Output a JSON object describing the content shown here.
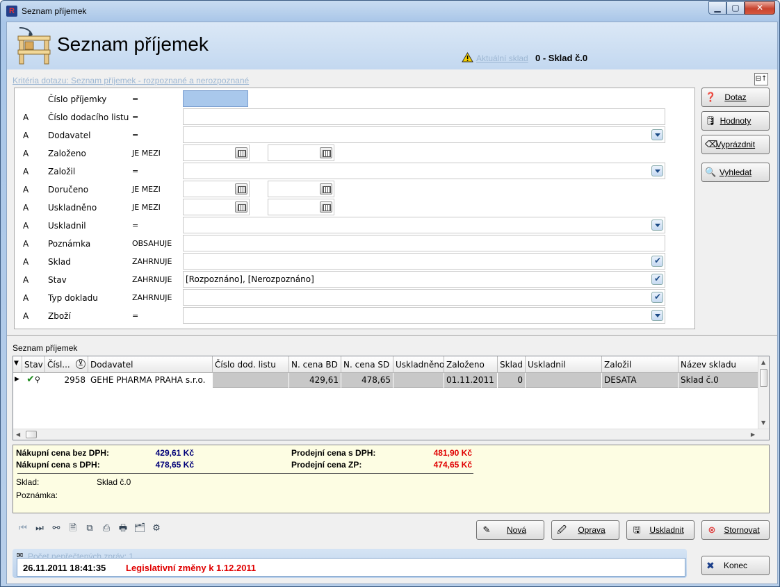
{
  "window": {
    "title": "Seznam příjemek",
    "app_icon": "R"
  },
  "header": {
    "title": "Seznam příjemek",
    "current_warehouse_label": "Aktuální sklad",
    "current_warehouse_value": "0 - Sklad č.0"
  },
  "criteria": {
    "link": "Kritéria dotazu: Seznam příjemek - rozpoznané a nerozpoznané",
    "rows": [
      {
        "a": "",
        "label": "Číslo příjemky",
        "op": "="
      },
      {
        "a": "A",
        "label": "Číslo dodacího listu",
        "op": "="
      },
      {
        "a": "A",
        "label": "Dodavatel",
        "op": "="
      },
      {
        "a": "A",
        "label": "Založeno",
        "op": "JE MEZI"
      },
      {
        "a": "A",
        "label": "Založil",
        "op": "="
      },
      {
        "a": "A",
        "label": "Doručeno",
        "op": "JE MEZI"
      },
      {
        "a": "A",
        "label": "Uskladněno",
        "op": "JE MEZI"
      },
      {
        "a": "A",
        "label": "Uskladnil",
        "op": "="
      },
      {
        "a": "A",
        "label": "Poznámka",
        "op": "OBSAHUJE"
      },
      {
        "a": "A",
        "label": "Sklad",
        "op": "ZAHRNUJE"
      },
      {
        "a": "A",
        "label": "Stav",
        "op": "ZAHRNUJE",
        "value": "[Rozpoznáno], [Nerozpoznáno]"
      },
      {
        "a": "A",
        "label": "Typ dokladu",
        "op": "ZAHRNUJE"
      },
      {
        "a": "A",
        "label": "Zboží",
        "op": "="
      }
    ]
  },
  "side_buttons": [
    "Dotaz",
    "Hodnoty",
    "Vyprázdnit",
    "Vyhledat"
  ],
  "grid": {
    "title": "Seznam příjemek",
    "columns": [
      "Stav",
      "Čísl...",
      "Dodavatel",
      "Číslo dod. listu",
      "N. cena BD",
      "N. cena SD",
      "Uskladněno",
      "Založeno",
      "Sklad",
      "Uskladnil",
      "Založil",
      "Název skladu"
    ],
    "rows": [
      {
        "cislo": "2958",
        "dodavatel": "GEHE PHARMA PRAHA s.r.o.",
        "cislo_dl": "",
        "cena_bd": "429,61",
        "cena_sd": "478,65",
        "uskladneno": "",
        "zalozeno": "01.11.2011",
        "sklad": "0",
        "uskladnil": "",
        "zalozil": "DESATA",
        "nazev_skladu": "Sklad č.0"
      }
    ]
  },
  "summary": {
    "nc_bez_label": "Nákupní cena bez DPH:",
    "nc_bez_value": "429,61 Kč",
    "nc_s_label": "Nákupní cena s DPH:",
    "nc_s_value": "478,65 Kč",
    "pc_s_label": "Prodejní cena s DPH:",
    "pc_s_value": "481,90 Kč",
    "pc_zp_label": "Prodejní cena ZP:",
    "pc_zp_value": "474,65 Kč",
    "sklad_label": "Sklad:",
    "sklad_value": "Sklad č.0",
    "poznamka_label": "Poznámka:"
  },
  "action_buttons": [
    "Nová",
    "Oprava",
    "Uskladnit",
    "Stornovat"
  ],
  "status": {
    "messages_link": "Počet nepřečtených zpráv: 1",
    "datetime": "26.11.2011 18:41:35",
    "news": "Legislativní změny k 1.12.2011"
  },
  "end_button": "Konec",
  "colors": {
    "accent": "#c3d8f0",
    "summary_bg": "#fdfde3",
    "red": "#e00000",
    "blue": "#000078"
  }
}
